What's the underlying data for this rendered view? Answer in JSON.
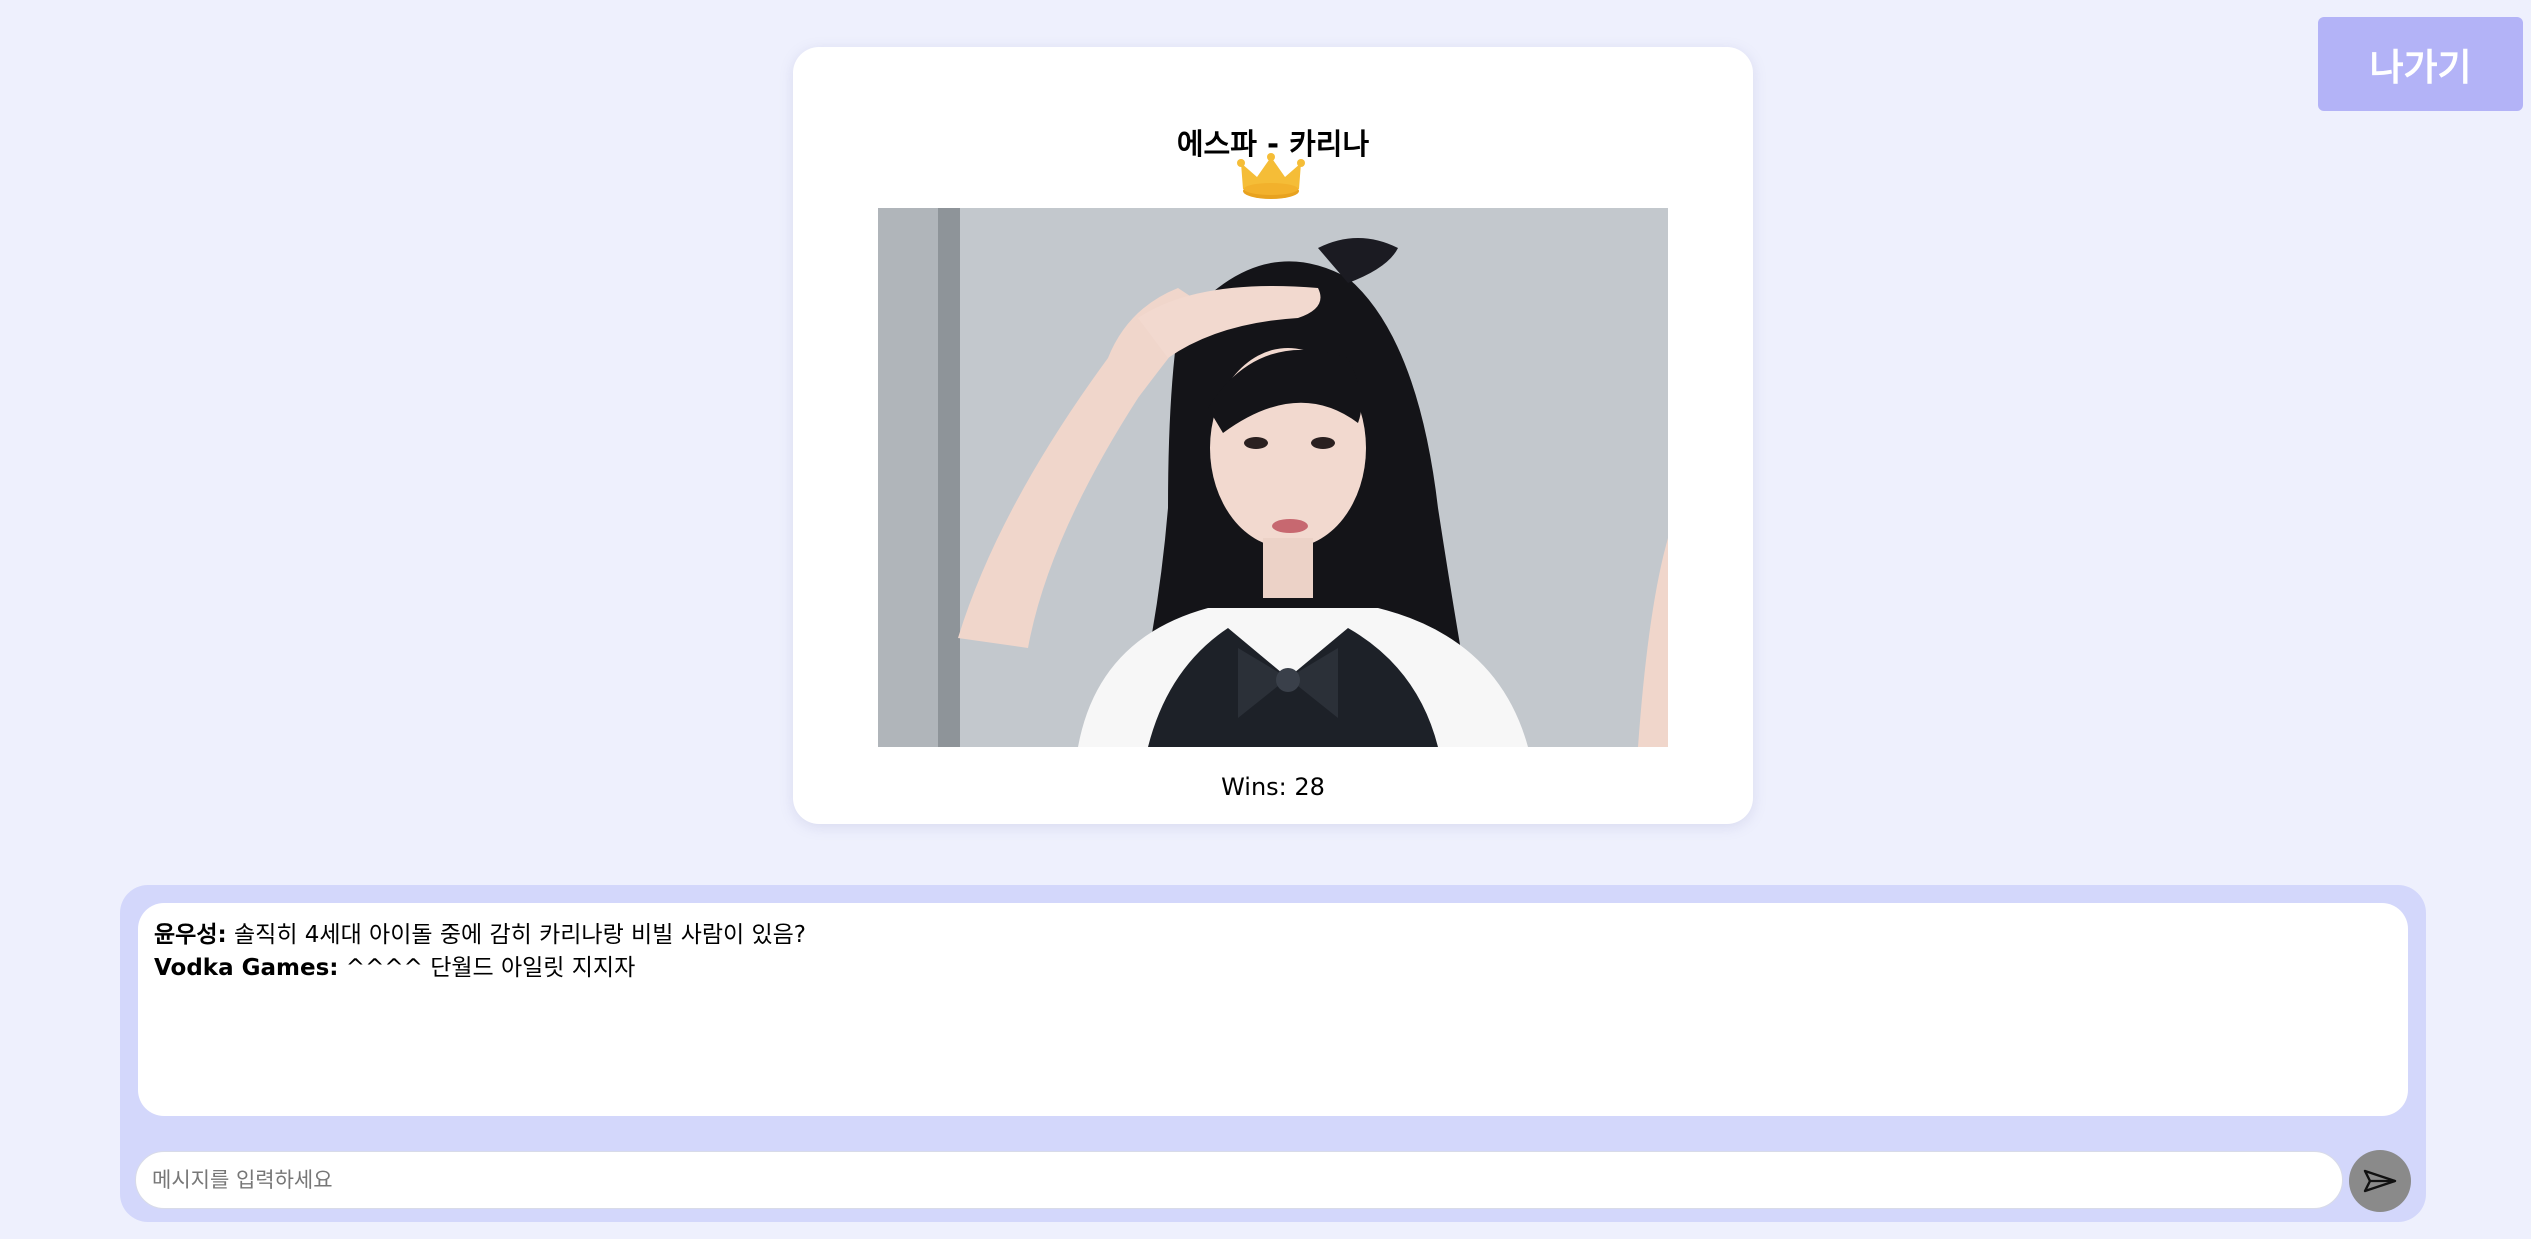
{
  "header": {
    "exit_label": "나가기"
  },
  "winner": {
    "title": "에스파 - 카리나",
    "crown_icon": "crown-icon",
    "wins_text": "Wins: 28"
  },
  "chat": {
    "messages": [
      {
        "sender": "윤우성:",
        "text": " 솔직히 4세대 아이돌 중에 감히 카리나랑 비빌 사람이 있음?"
      },
      {
        "sender": "Vodka Games:",
        "text": " ^^^^ 단월드 아일릿 지지자"
      }
    ],
    "input_placeholder": "메시지를 입력하세요",
    "input_value": "",
    "send_icon": "send-icon"
  },
  "colors": {
    "background": "#eef0fd",
    "exit_button": "#b3b3f7",
    "chat_panel": "#d3d7fb",
    "crown": "#f2b730",
    "send_button": "#8a8a8a"
  }
}
